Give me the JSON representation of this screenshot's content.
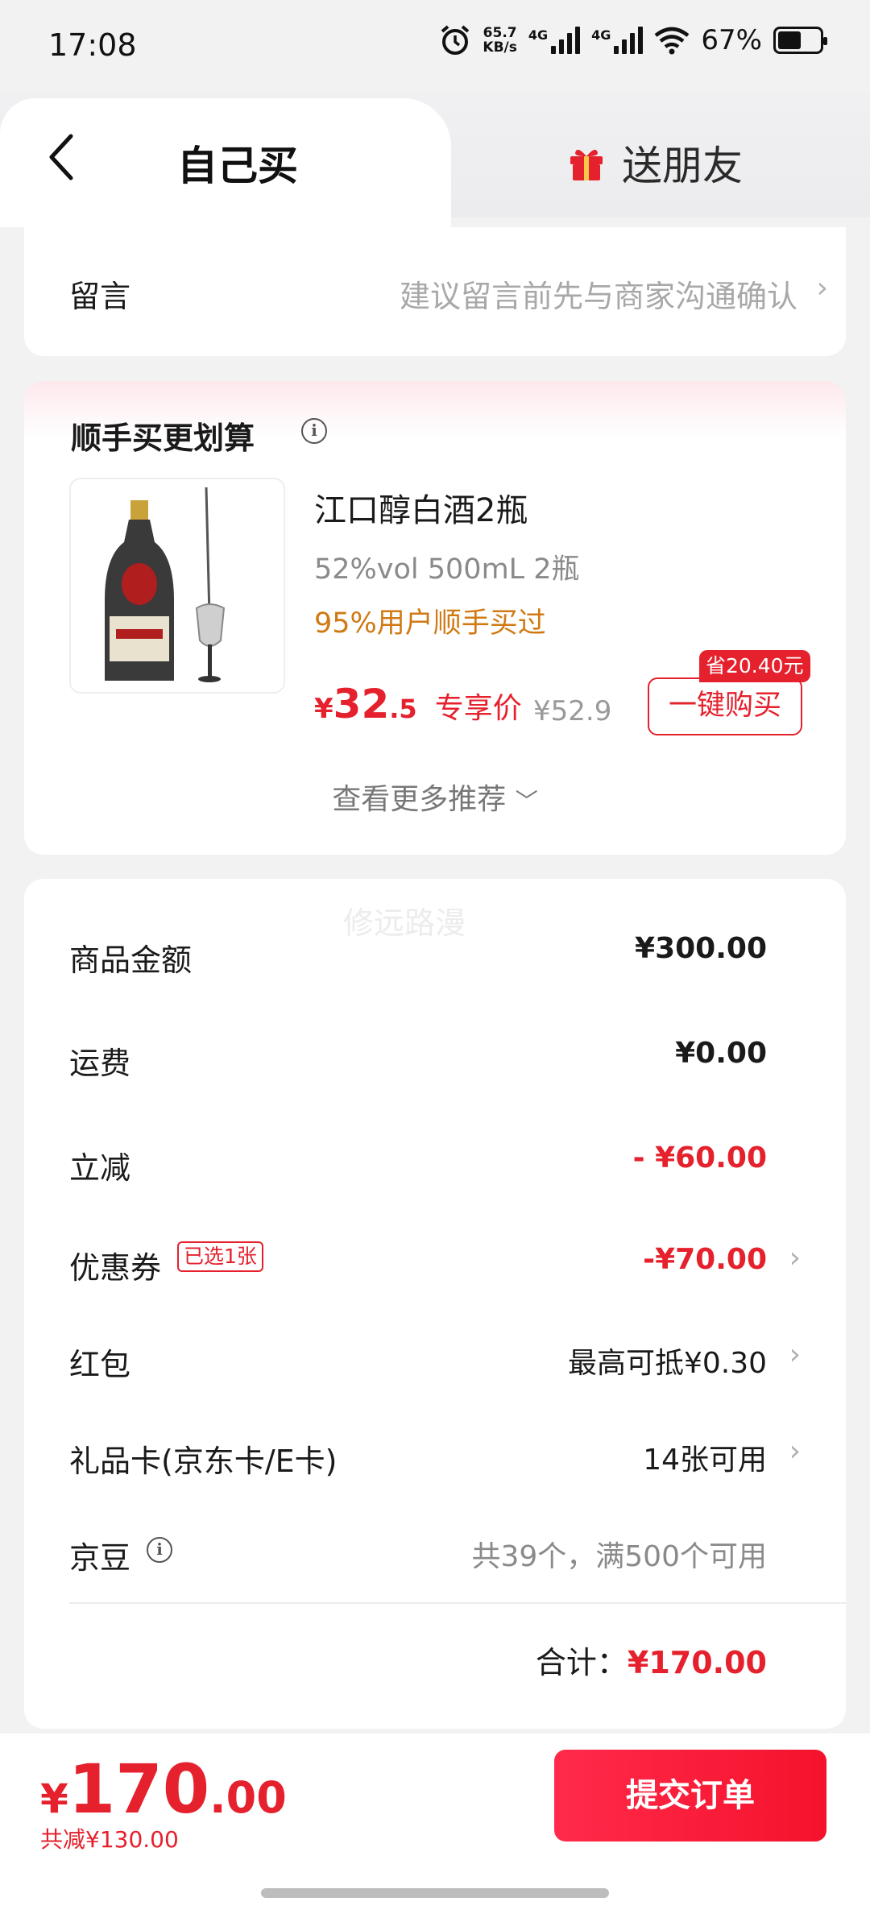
{
  "status_bar": {
    "time": "17:08",
    "net_speed_value": "65.7",
    "net_speed_unit": "KB/s",
    "sim1": "4G",
    "sim2": "4G",
    "battery_percent": "67%"
  },
  "tabs": {
    "self_label": "自己买",
    "gift_label": "送朋友"
  },
  "note": {
    "label": "留言",
    "hint": "建议留言前先与商家沟通确认"
  },
  "recommend": {
    "title": "顺手买更划算",
    "product": {
      "name": "江口醇白酒2瓶",
      "spec": "52%vol 500mL 2瓶",
      "social_proof": "95%用户顺手买过",
      "price_currency": "¥",
      "price_int": "32",
      "price_dec": ".5",
      "price_tag": "专享价",
      "original_price": "¥52.9",
      "buy_label": "一键购买",
      "save_badge": "省20.40元"
    },
    "more_label": "查看更多推荐"
  },
  "summary": {
    "watermark": "修远路漫",
    "rows": [
      {
        "label": "商品金额",
        "value": "¥300.00"
      },
      {
        "label": "运费",
        "value": "¥0.00"
      },
      {
        "label": "立减",
        "value": "- ¥60.00"
      },
      {
        "label": "优惠券",
        "badge": "已选1张",
        "value": "-¥70.00"
      },
      {
        "label": "红包",
        "value": "最高可抵¥0.30"
      },
      {
        "label": "礼品卡(京东卡/E卡)",
        "value": "14张可用"
      },
      {
        "label": "京豆",
        "value": "共39个，满500个可用"
      }
    ],
    "total_label": "合计：",
    "total_value": "¥170.00"
  },
  "bottom": {
    "currency": "¥",
    "amount_int": "170",
    "amount_dec": ".00",
    "saved": "共减¥130.00",
    "submit_label": "提交订单"
  },
  "colors": {
    "accent": "#e5212d",
    "social_proof": "#d07a14"
  }
}
